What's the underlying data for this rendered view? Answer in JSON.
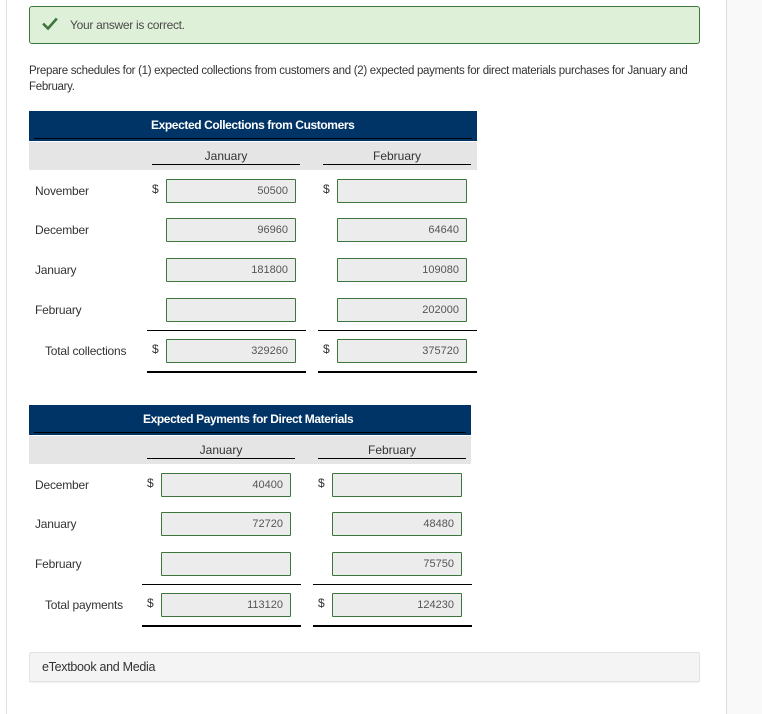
{
  "feedback": {
    "icon": "check-icon",
    "message": "Your answer is correct.",
    "accent_color": "#3c763d",
    "background_color": "#dff0d8"
  },
  "instructions": "Prepare schedules for (1) expected collections from customers and (2) expected payments for direct materials purchases for January and February.",
  "collections": {
    "title": "Expected Collections from Customers",
    "columns": [
      "January",
      "February"
    ],
    "currency": "$",
    "rows": [
      {
        "label": "November",
        "values": [
          "50500",
          ""
        ]
      },
      {
        "label": "December",
        "values": [
          "96960",
          "64640"
        ]
      },
      {
        "label": "January",
        "values": [
          "181800",
          "109080"
        ]
      },
      {
        "label": "February",
        "values": [
          "",
          "202000"
        ]
      }
    ],
    "total": {
      "label": "Total collections",
      "values": [
        "329260",
        "375720"
      ]
    }
  },
  "payments": {
    "title": "Expected Payments for Direct Materials",
    "columns": [
      "January",
      "February"
    ],
    "currency": "$",
    "rows": [
      {
        "label": "December",
        "values": [
          "40400",
          ""
        ]
      },
      {
        "label": "January",
        "values": [
          "72720",
          "48480"
        ]
      },
      {
        "label": "February",
        "values": [
          "",
          "75750"
        ]
      }
    ],
    "total": {
      "label": "Total payments",
      "values": [
        "113120",
        "124230"
      ]
    }
  },
  "header_color": "#003466",
  "etextbook": {
    "label": "eTextbook and Media"
  }
}
